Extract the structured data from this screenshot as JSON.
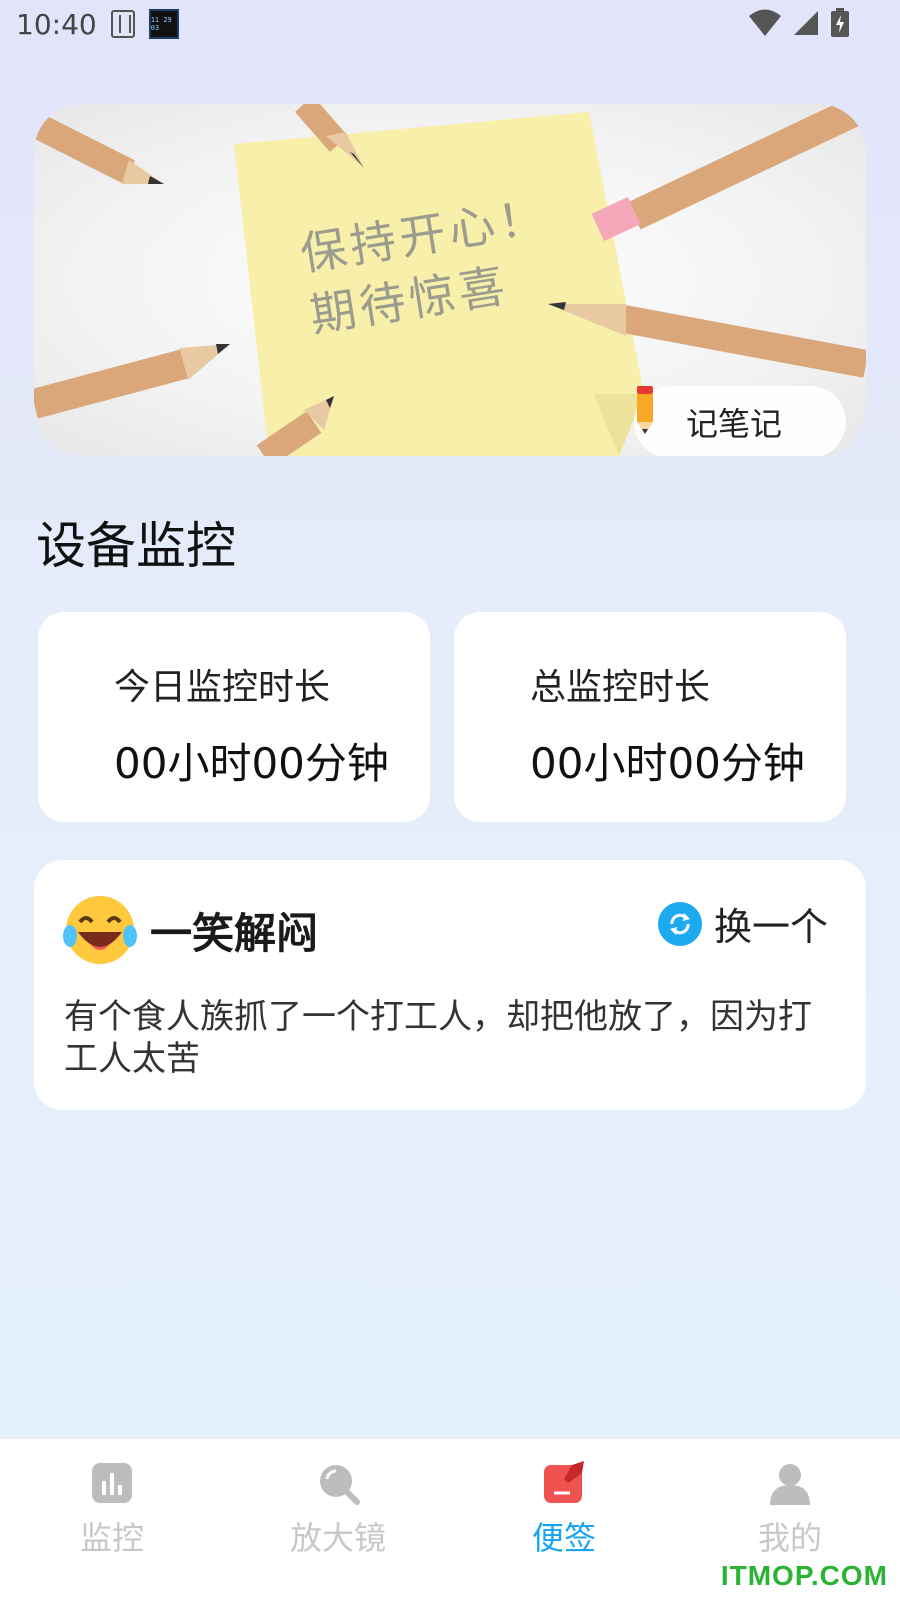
{
  "status_bar": {
    "time": "10:40",
    "app_thumb_text": "11 29 03"
  },
  "banner": {
    "note_line1": "保持开心！",
    "note_line2": "期待惊喜",
    "button_label": "记笔记"
  },
  "section_title": "设备监控",
  "stats": {
    "today": {
      "label": "今日监控时长",
      "value": "00小时00分钟"
    },
    "total": {
      "label": "总监控时长",
      "value": "00小时00分钟"
    }
  },
  "joke": {
    "title": "一笑解闷",
    "refresh_label": "换一个",
    "text": "有个食人族抓了一个打工人，却把他放了，因为打工人太苦"
  },
  "nav": {
    "items": [
      {
        "label": "监控",
        "icon": "bar-chart-icon",
        "active": false
      },
      {
        "label": "放大镜",
        "icon": "magnifier-icon",
        "active": false
      },
      {
        "label": "便签",
        "icon": "note-icon",
        "active": true
      },
      {
        "label": "我的",
        "icon": "person-icon",
        "active": false
      }
    ]
  },
  "watermark": "ITMOP.COM",
  "colors": {
    "accent": "#1aa4f0",
    "nav_inactive": "#c8c8c8",
    "note_active": "#ef5350"
  }
}
